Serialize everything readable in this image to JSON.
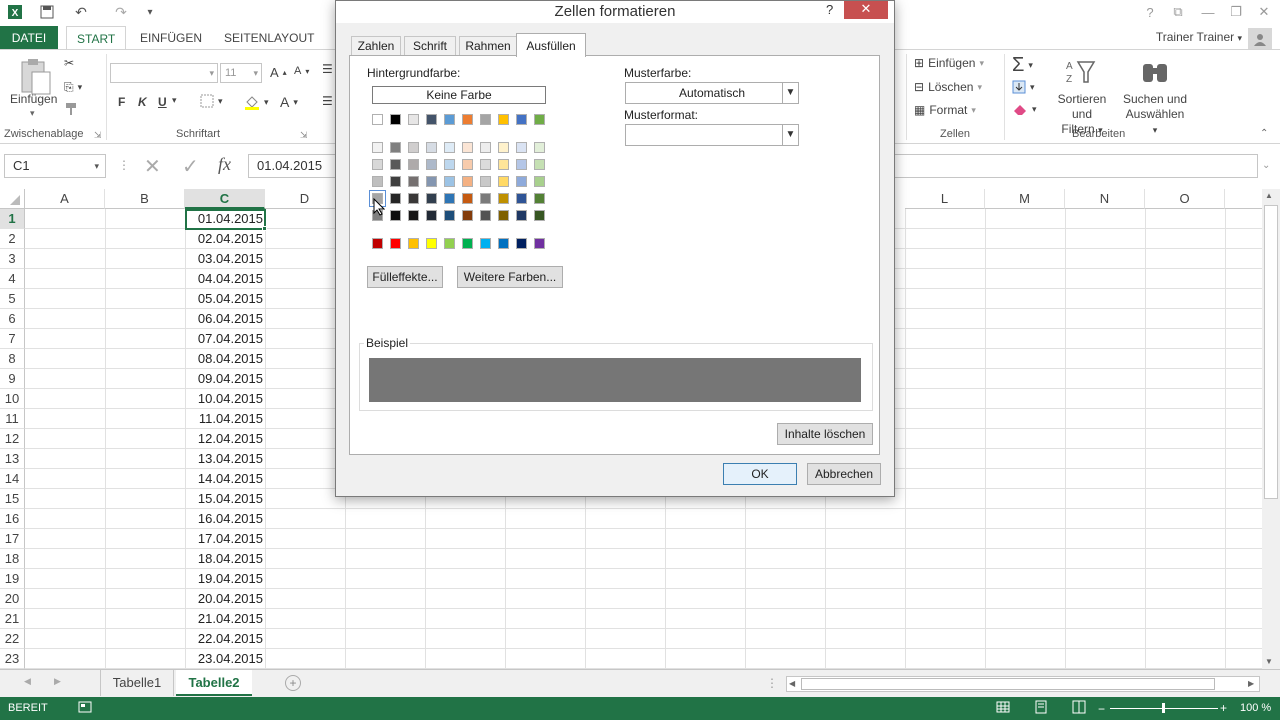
{
  "app": {
    "qat": {
      "undo": "↶",
      "redo": "↷"
    },
    "window_help": "?",
    "user": "Trainer Trainer"
  },
  "ribbon": {
    "tabs": [
      "DATEI",
      "START",
      "EINFÜGEN",
      "SEITENLAYOUT"
    ],
    "clipboard": {
      "paste": "Einfügen",
      "group": "Zwischenablage"
    },
    "font": {
      "name": "",
      "size": "11",
      "bold": "F",
      "italic": "K",
      "underline": "U",
      "group": "Schriftart"
    },
    "cells": {
      "insert": "Einfügen",
      "delete": "Löschen",
      "format": "Format",
      "group": "Zellen"
    },
    "editing": {
      "sort1": "Sortieren und",
      "sort2": "Filtern",
      "find1": "Suchen und",
      "find2": "Auswählen",
      "group": "Bearbeiten"
    }
  },
  "formula": {
    "namebox": "C1",
    "value": "01.04.2015",
    "fx": "fx"
  },
  "grid": {
    "columns": [
      "A",
      "B",
      "C",
      "D",
      "L",
      "M",
      "N",
      "O"
    ],
    "rows": [
      "1",
      "2",
      "3",
      "4",
      "5",
      "6",
      "7",
      "8",
      "9",
      "10",
      "11",
      "12",
      "13",
      "14",
      "15",
      "16",
      "17",
      "18",
      "19",
      "20",
      "21",
      "22",
      "23"
    ],
    "col_c": [
      "01.04.2015",
      "02.04.2015",
      "03.04.2015",
      "04.04.2015",
      "05.04.2015",
      "06.04.2015",
      "07.04.2015",
      "08.04.2015",
      "09.04.2015",
      "10.04.2015",
      "11.04.2015",
      "12.04.2015",
      "13.04.2015",
      "14.04.2015",
      "15.04.2015",
      "16.04.2015",
      "17.04.2015",
      "18.04.2015",
      "19.04.2015",
      "20.04.2015",
      "21.04.2015",
      "22.04.2015",
      "23.04.2015"
    ]
  },
  "sheets": [
    "Tabelle1",
    "Tabelle2"
  ],
  "status": {
    "left": "BEREIT",
    "zoom": "100 %"
  },
  "dialog": {
    "title": "Zellen formatieren",
    "close": "✕",
    "tabs": [
      "Zahlen",
      "Schrift",
      "Rahmen",
      "Ausfüllen"
    ],
    "bg_label": "Hintergrundfarbe:",
    "no_color": "Keine Farbe",
    "pattern_color_label": "Musterfarbe:",
    "pattern_color_value": "Automatisch",
    "pattern_format_label": "Musterformat:",
    "fill_effects": "Fülleffekte...",
    "more_colors": "Weitere Farben...",
    "sample_label": "Beispiel",
    "clear": "Inhalte löschen",
    "ok": "OK",
    "cancel": "Abbrechen",
    "preview_color": "#767676",
    "theme_row": [
      "#ffffff",
      "#000000",
      "#e7e6e6",
      "#44546a",
      "#5b9bd5",
      "#ed7d31",
      "#a5a5a5",
      "#ffc000",
      "#4472c4",
      "#70ad47"
    ],
    "tints": [
      [
        "#f2f2f2",
        "#7f7f7f",
        "#d0cece",
        "#d6dce4",
        "#deebf6",
        "#fbe5d5",
        "#ededed",
        "#fff2cc",
        "#dae3f3",
        "#e2efd9"
      ],
      [
        "#d8d8d8",
        "#595959",
        "#aeaaaa",
        "#adb9ca",
        "#bdd7ee",
        "#f7cbac",
        "#dbdbdb",
        "#fee599",
        "#b4c6e7",
        "#c5e0b3"
      ],
      [
        "#bfbfbf",
        "#3f3f3f",
        "#757070",
        "#8496b0",
        "#9cc3e5",
        "#f4b183",
        "#c9c9c9",
        "#ffd965",
        "#8eaadb",
        "#a8d08d"
      ],
      [
        "#a5a5a5",
        "#262626",
        "#3a3838",
        "#323f4f",
        "#2e75b5",
        "#c55a11",
        "#7b7b7b",
        "#bf9000",
        "#2f5496",
        "#538135"
      ],
      [
        "#7f7f7f",
        "#0c0c0c",
        "#171616",
        "#222a35",
        "#1e4e79",
        "#833c0b",
        "#525252",
        "#7f6000",
        "#1f3864",
        "#375623"
      ]
    ],
    "standard": [
      "#c00000",
      "#ff0000",
      "#ffc000",
      "#ffff00",
      "#92d050",
      "#00b050",
      "#00b0f0",
      "#0070c0",
      "#002060",
      "#7030a0"
    ]
  }
}
